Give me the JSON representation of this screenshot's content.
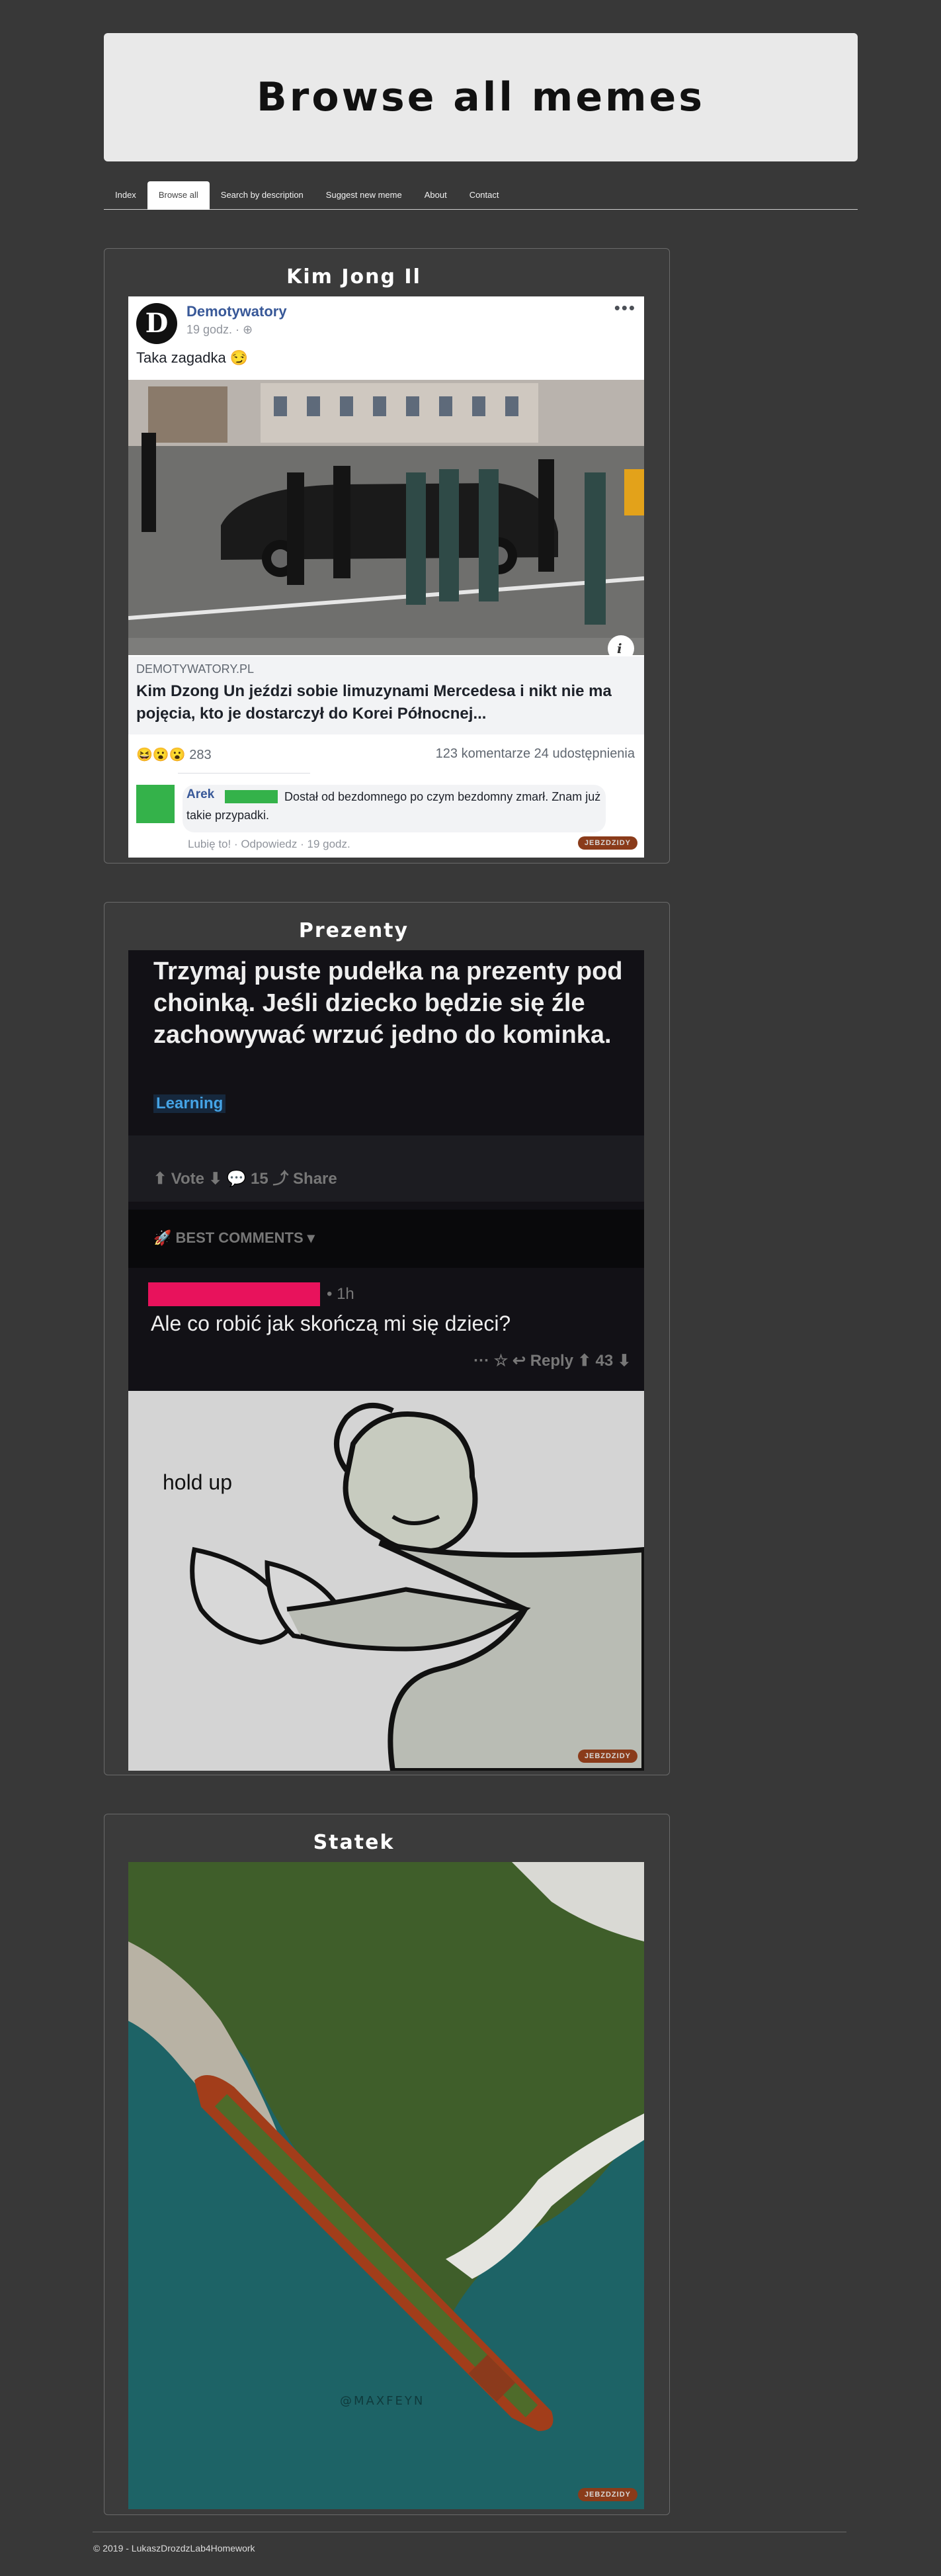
{
  "header": {
    "title": "Browse all memes"
  },
  "nav": {
    "items": [
      {
        "label": "Index"
      },
      {
        "label": "Browse all"
      },
      {
        "label": "Search by description"
      },
      {
        "label": "Suggest new meme"
      },
      {
        "label": "About"
      },
      {
        "label": "Contact"
      }
    ]
  },
  "memes": [
    {
      "title": "Kim Jong Il",
      "page_name": "Demotywatory",
      "post_time": "19 godz. · ⊕",
      "post_text": "Taka zagadka 😏",
      "link_source": "DEMOTYWATORY.PL",
      "link_headline": "Kim Dzong Un jeździ sobie limuzynami Mercedesa i nikt nie ma pojęcia, kto je dostarczył do Korei Północnej...",
      "reactions": "😆😮😮 283",
      "stats": "123 komentarze  24 udostępnienia",
      "comment_author": "Arek",
      "comment_text": "Dostał od bezdomnego po czym bezdomny zmarł. Znam już takie przypadki.",
      "comment_actions": "Lubię to! · Odpowiedz · 19 godz.",
      "watermark": "JEBZDZIDY"
    },
    {
      "title": "Prezenty",
      "post_text": "Trzymaj puste pudełka na prezenty pod choinką. Jeśli dziecko będzie się źle zachowywać wrzuć jedno do kominka.",
      "tag": "Learning",
      "vote_bar": "⬆ Vote ⬇     💬 15          ⤴ Share",
      "best_comments": "🚀 BEST COMMENTS ▾",
      "reply_time": "• 1h",
      "reply_text": "Ale co robić jak skończą mi się dzieci?",
      "reply_actions": "···   ☆   ↩ Reply   ⬆ 43 ⬇",
      "image_caption": "hold up",
      "watermark": "JEBZDZIDY"
    },
    {
      "title": "Statek",
      "photo_credit": "@MAXFEYN",
      "watermark": "JEBZDZIDY"
    }
  ],
  "footer": {
    "text": "© 2019 - LukaszDrozdzLab4Homework"
  }
}
